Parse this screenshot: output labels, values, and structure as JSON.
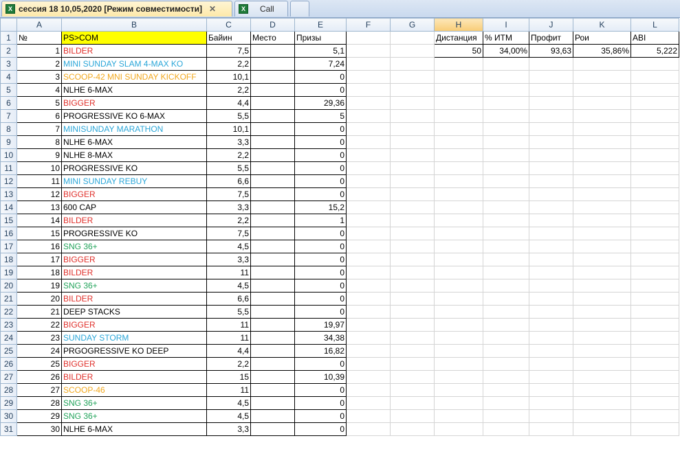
{
  "tabs": [
    {
      "label": "сессия 18 10,05,2020  [Режим совместимости]",
      "active": true,
      "icon": "excel-icon"
    },
    {
      "label": "Call",
      "active": false,
      "icon": "excel-icon"
    }
  ],
  "columns": [
    "A",
    "B",
    "C",
    "D",
    "E",
    "F",
    "G",
    "H",
    "I",
    "J",
    "K",
    "L"
  ],
  "selected_column": "H",
  "headers": {
    "a": "№",
    "b": "PS>COM",
    "c": "Байин",
    "d": "Место",
    "e": "Призы",
    "h": "Дистанция",
    "i": "% ИТМ",
    "j": "Профит",
    "k": "Рои",
    "l": "ABI"
  },
  "stats": {
    "distance": "50",
    "itm": "34,00%",
    "profit": "93,63",
    "roi": "35,86%",
    "abi": "5,222"
  },
  "colors": {
    "red": "#e0302b",
    "blue": "#2aa6d8",
    "orange": "#f2a81d",
    "green": "#21a35a"
  },
  "rows": [
    {
      "n": "1",
      "name": "BILDER",
      "color": "red",
      "buyin": "7,5",
      "place": "",
      "prize": "5,1"
    },
    {
      "n": "2",
      "name": "MINI SUNDAY SLAM 4-MAX KO",
      "color": "blue",
      "buyin": "2,2",
      "place": "",
      "prize": "7,24"
    },
    {
      "n": "3",
      "name": "SCOOP-42 MNI SUNDAY KICKOFF",
      "color": "orange",
      "buyin": "10,1",
      "place": "",
      "prize": "0"
    },
    {
      "n": "4",
      "name": "NLHE 6-MAX",
      "color": "black",
      "buyin": "2,2",
      "place": "",
      "prize": "0"
    },
    {
      "n": "5",
      "name": "BIGGER",
      "color": "red",
      "buyin": "4,4",
      "place": "",
      "prize": "29,36"
    },
    {
      "n": "6",
      "name": "PROGRESSIVE KO 6-MAX",
      "color": "black",
      "buyin": "5,5",
      "place": "",
      "prize": "5"
    },
    {
      "n": "7",
      "name": "MINISUNDAY MARATHON",
      "color": "blue",
      "buyin": "10,1",
      "place": "",
      "prize": "0"
    },
    {
      "n": "8",
      "name": "NLHE 6-MAX",
      "color": "black",
      "buyin": "3,3",
      "place": "",
      "prize": "0"
    },
    {
      "n": "9",
      "name": "NLHE 8-MAX",
      "color": "black",
      "buyin": "2,2",
      "place": "",
      "prize": "0"
    },
    {
      "n": "10",
      "name": "PROGRESSIVE KO",
      "color": "black",
      "buyin": "5,5",
      "place": "",
      "prize": "0"
    },
    {
      "n": "11",
      "name": "MINI SUNDAY REBUY",
      "color": "blue",
      "buyin": "6,6",
      "place": "",
      "prize": "0"
    },
    {
      "n": "12",
      "name": "BIGGER",
      "color": "red",
      "buyin": "7,5",
      "place": "",
      "prize": "0"
    },
    {
      "n": "13",
      "name": "600 CAP",
      "color": "black",
      "buyin": "3,3",
      "place": "",
      "prize": "15,2"
    },
    {
      "n": "14",
      "name": "BILDER",
      "color": "red",
      "buyin": "2,2",
      "place": "",
      "prize": "1"
    },
    {
      "n": "15",
      "name": "PROGRESSIVE KO",
      "color": "black",
      "buyin": "7,5",
      "place": "",
      "prize": "0"
    },
    {
      "n": "16",
      "name": "SNG 36+",
      "color": "green",
      "buyin": "4,5",
      "place": "",
      "prize": "0"
    },
    {
      "n": "17",
      "name": "BIGGER",
      "color": "red",
      "buyin": "3,3",
      "place": "",
      "prize": "0"
    },
    {
      "n": "18",
      "name": "BILDER",
      "color": "red",
      "buyin": "11",
      "place": "",
      "prize": "0"
    },
    {
      "n": "19",
      "name": "SNG 36+",
      "color": "green",
      "buyin": "4,5",
      "place": "",
      "prize": "0"
    },
    {
      "n": "20",
      "name": "BILDER",
      "color": "red",
      "buyin": "6,6",
      "place": "",
      "prize": "0"
    },
    {
      "n": "21",
      "name": "DEEP STACKS",
      "color": "black",
      "buyin": "5,5",
      "place": "",
      "prize": "0"
    },
    {
      "n": "22",
      "name": "BIGGER",
      "color": "red",
      "buyin": "11",
      "place": "",
      "prize": "19,97"
    },
    {
      "n": "23",
      "name": "SUNDAY STORM",
      "color": "blue",
      "buyin": "11",
      "place": "",
      "prize": "34,38"
    },
    {
      "n": "24",
      "name": "PRGOGRESSIVE KO DEEP",
      "color": "black",
      "buyin": "4,4",
      "place": "",
      "prize": "16,82"
    },
    {
      "n": "25",
      "name": "BIGGER",
      "color": "red",
      "buyin": "2,2",
      "place": "",
      "prize": "0"
    },
    {
      "n": "26",
      "name": "BILDER",
      "color": "red",
      "buyin": "15",
      "place": "",
      "prize": "10,39"
    },
    {
      "n": "27",
      "name": "SCOOP-46",
      "color": "orange",
      "buyin": "11",
      "place": "",
      "prize": "0"
    },
    {
      "n": "28",
      "name": "SNG 36+",
      "color": "green",
      "buyin": "4,5",
      "place": "",
      "prize": "0"
    },
    {
      "n": "29",
      "name": "SNG 36+",
      "color": "green",
      "buyin": "4,5",
      "place": "",
      "prize": "0"
    },
    {
      "n": "30",
      "name": "NLHE 6-MAX",
      "color": "black",
      "buyin": "3,3",
      "place": "",
      "prize": "0"
    }
  ]
}
